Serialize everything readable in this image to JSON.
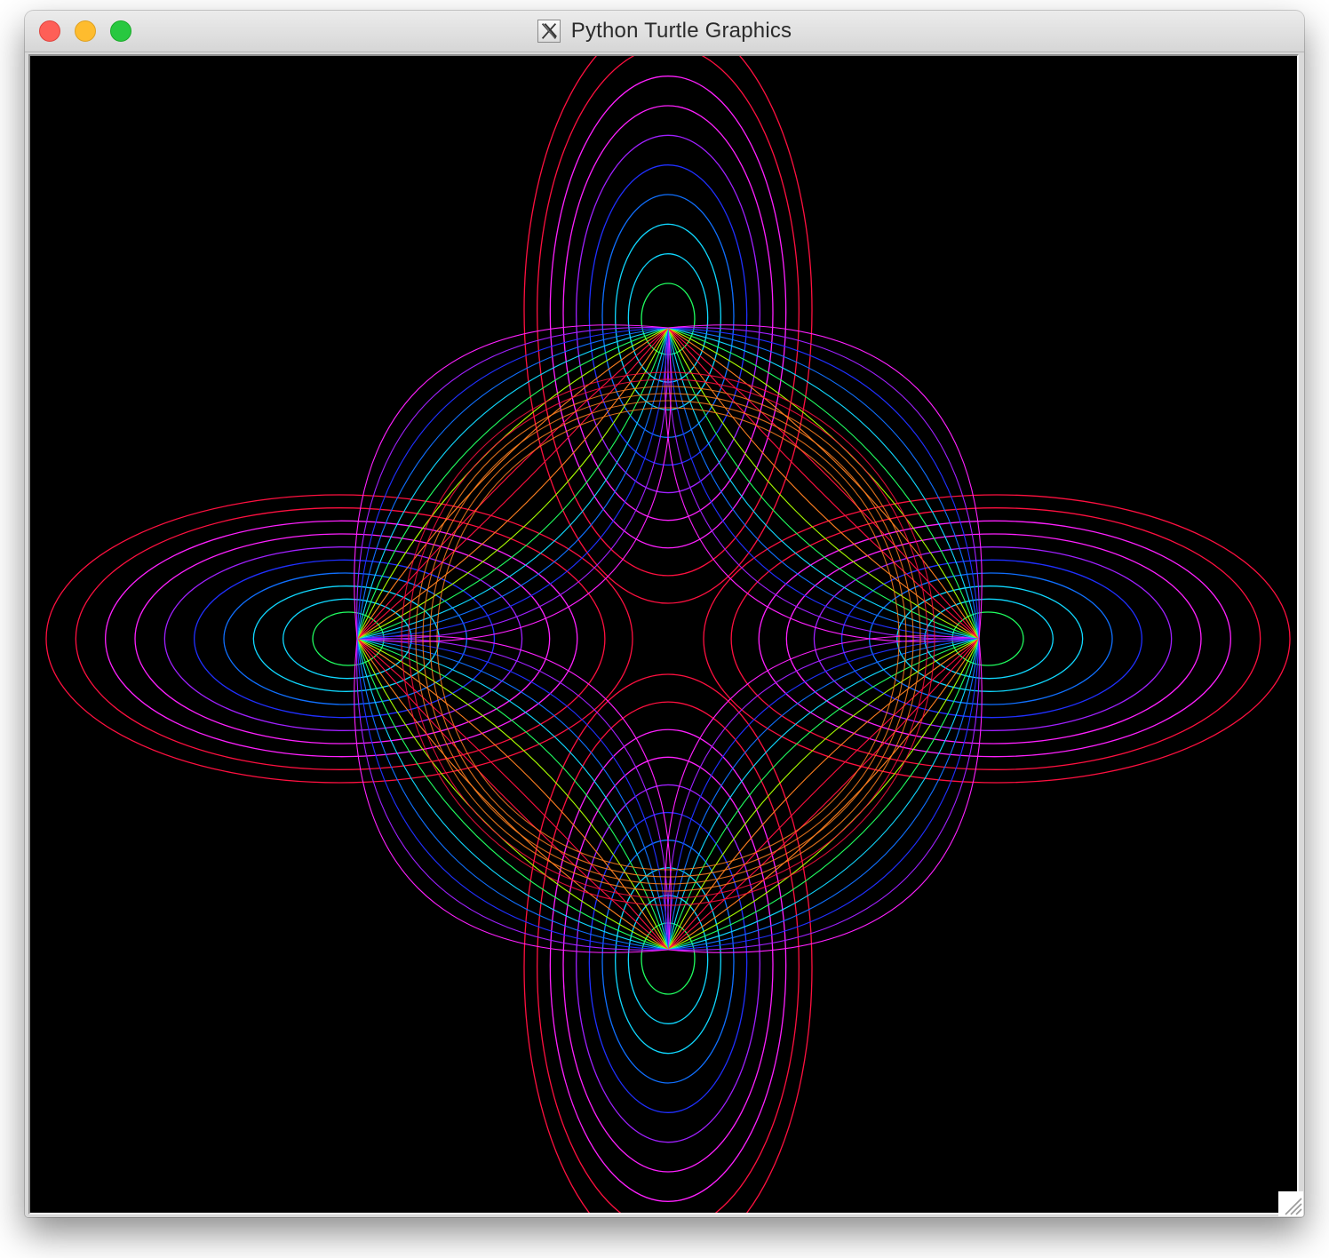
{
  "window": {
    "title": "Python Turtle Graphics",
    "icon": "x11-icon",
    "controls": {
      "close": "close-icon",
      "minimize": "minimize-icon",
      "zoom": "zoom-icon"
    }
  },
  "canvas": {
    "background": "#000000",
    "figure": "four-lobed rainbow spirograph of nested loops",
    "lobe_count": 4,
    "loops_per_lobe": 10,
    "diamond_curves_per_side": 18,
    "palette": {
      "outer": "#ff1040",
      "magenta": "#ff20ff",
      "violet": "#a020ff",
      "blue": "#2030ff",
      "azure": "#1070ff",
      "cyan": "#10d8ff",
      "green": "#20ff60",
      "yellow_green": "#aaff00",
      "orange": "#ff8020"
    }
  },
  "resize_grip_icon": "resize-grip-icon"
}
